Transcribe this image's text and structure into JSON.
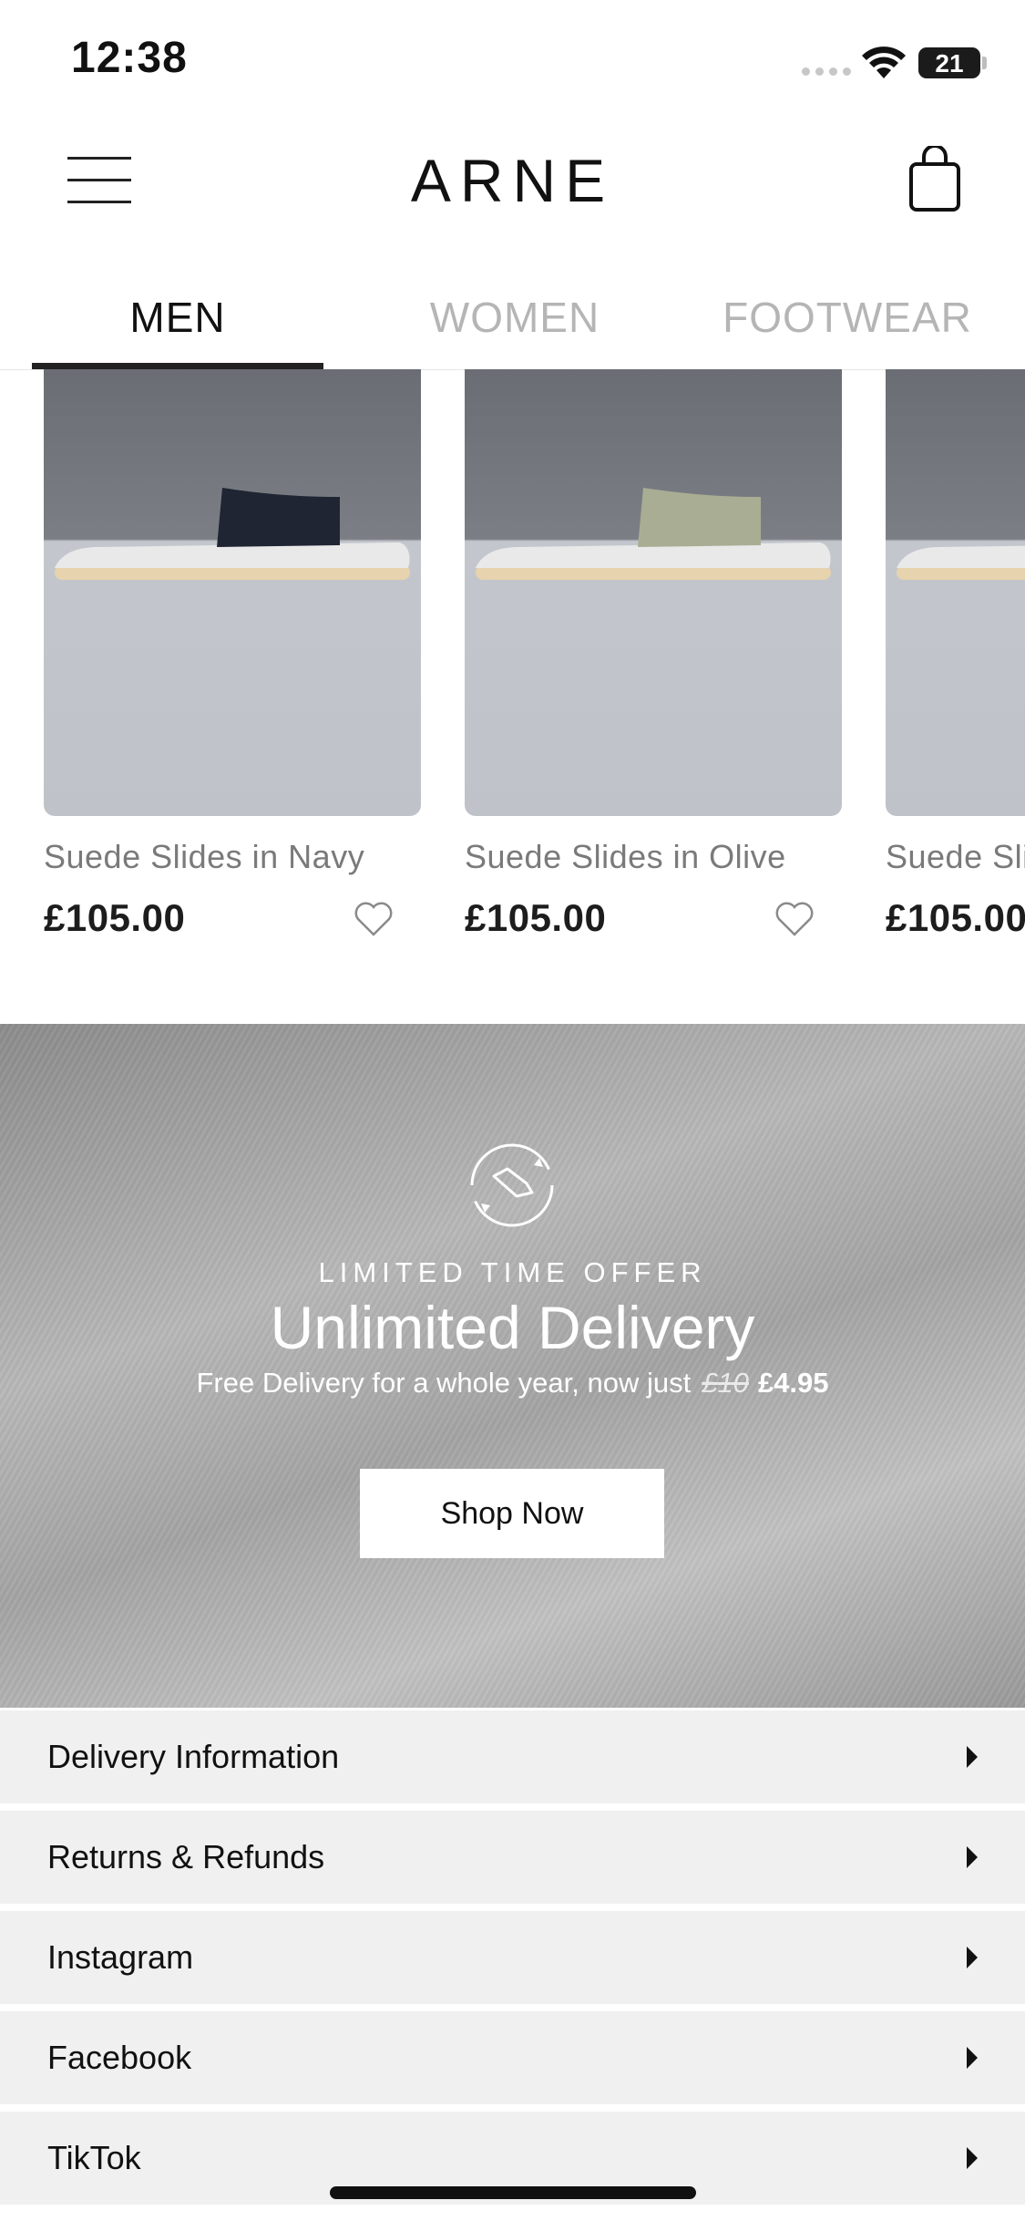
{
  "status_bar": {
    "time": "12:38",
    "battery": "21"
  },
  "header": {
    "brand": "ARNE"
  },
  "tabs": [
    {
      "label": "MEN",
      "active": true
    },
    {
      "label": "WOMEN",
      "active": false
    },
    {
      "label": "FOOTWEAR",
      "active": false
    }
  ],
  "products": [
    {
      "name": "Suede Slides in Navy",
      "price": "£105.00",
      "strap_color": "#1f2533"
    },
    {
      "name": "Suede Slides in Olive",
      "price": "£105.00",
      "strap_color": "#a9ad93"
    },
    {
      "name": "Suede Sli",
      "price": "£105.00",
      "strap_color": "#8a8a8a"
    }
  ],
  "promo": {
    "eyebrow": "LIMITED TIME OFFER",
    "headline": "Unlimited Delivery",
    "subtext": "Free Delivery for a whole year, now just",
    "old_price": "£10",
    "new_price": "£4.95",
    "cta": "Shop Now"
  },
  "footer_links": [
    {
      "label": "Delivery Information"
    },
    {
      "label": "Returns & Refunds"
    },
    {
      "label": "Instagram"
    },
    {
      "label": "Facebook"
    },
    {
      "label": "TikTok"
    }
  ]
}
